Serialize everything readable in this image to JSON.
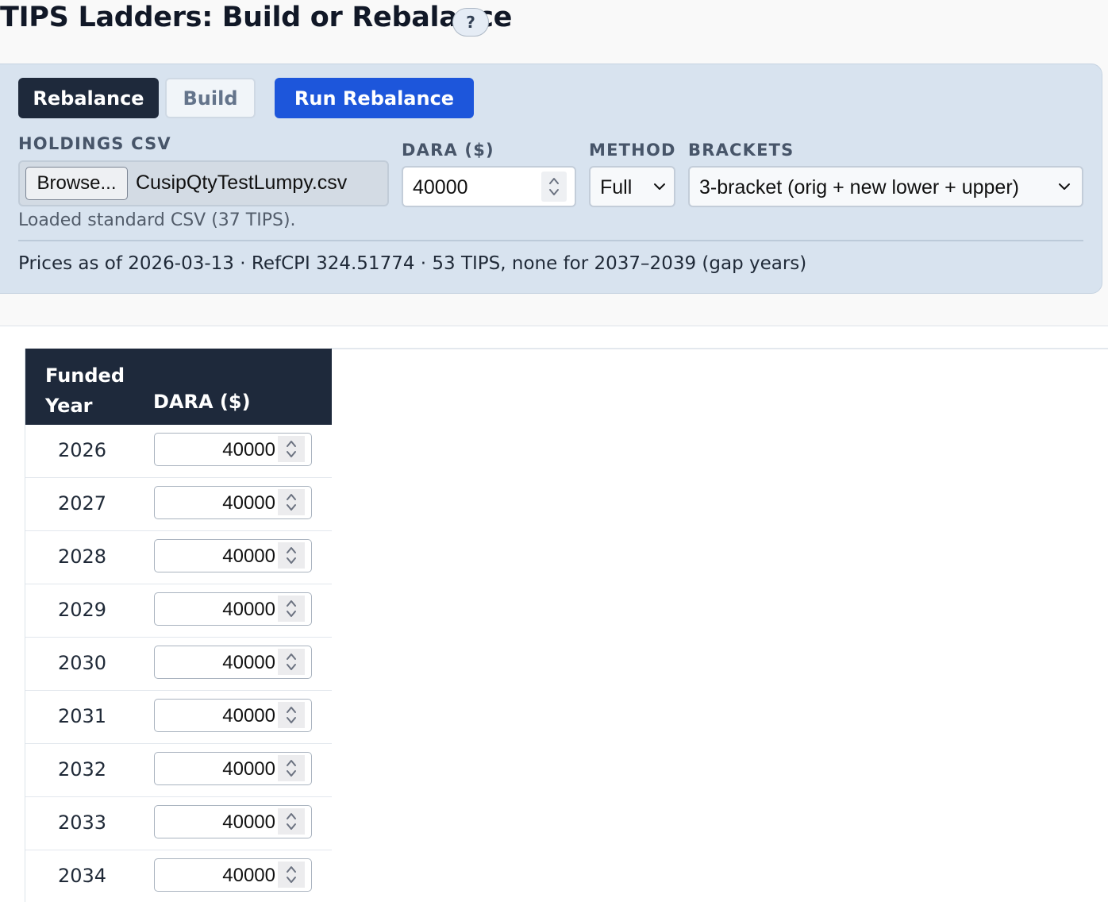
{
  "header": {
    "title": "TIPS Ladders: Build or Rebalance",
    "help_label": "?"
  },
  "controls": {
    "mode_tabs": [
      {
        "label": "Rebalance",
        "active": true
      },
      {
        "label": "Build",
        "active": false
      }
    ],
    "run_button_label": "Run Rebalance",
    "holdings": {
      "label": "HOLDINGS CSV",
      "browse_label": "Browse...",
      "file_name": "CusipQtyTestLumpy.csv",
      "status": "Loaded standard CSV (37 TIPS)."
    },
    "dara": {
      "label": "DARA ($)",
      "value": "40000"
    },
    "method": {
      "label": "METHOD",
      "value": "Full"
    },
    "brackets": {
      "label": "BRACKETS",
      "value": "3-bracket (orig + new lower + upper)"
    },
    "info_line": "Prices as of 2026-03-13 · RefCPI 324.51774 · 53 TIPS, none for 2037–2039 (gap years)"
  },
  "table": {
    "headers": {
      "year": "Funded Year",
      "dara": "DARA ($)"
    },
    "rows": [
      {
        "year": "2026",
        "dara": "40000"
      },
      {
        "year": "2027",
        "dara": "40000"
      },
      {
        "year": "2028",
        "dara": "40000"
      },
      {
        "year": "2029",
        "dara": "40000"
      },
      {
        "year": "2030",
        "dara": "40000"
      },
      {
        "year": "2031",
        "dara": "40000"
      },
      {
        "year": "2032",
        "dara": "40000"
      },
      {
        "year": "2033",
        "dara": "40000"
      },
      {
        "year": "2034",
        "dara": "40000"
      }
    ]
  },
  "colors": {
    "dark_navy": "#1e293b",
    "primary_blue": "#1d56db",
    "panel_bg": "#d8e3ef"
  }
}
